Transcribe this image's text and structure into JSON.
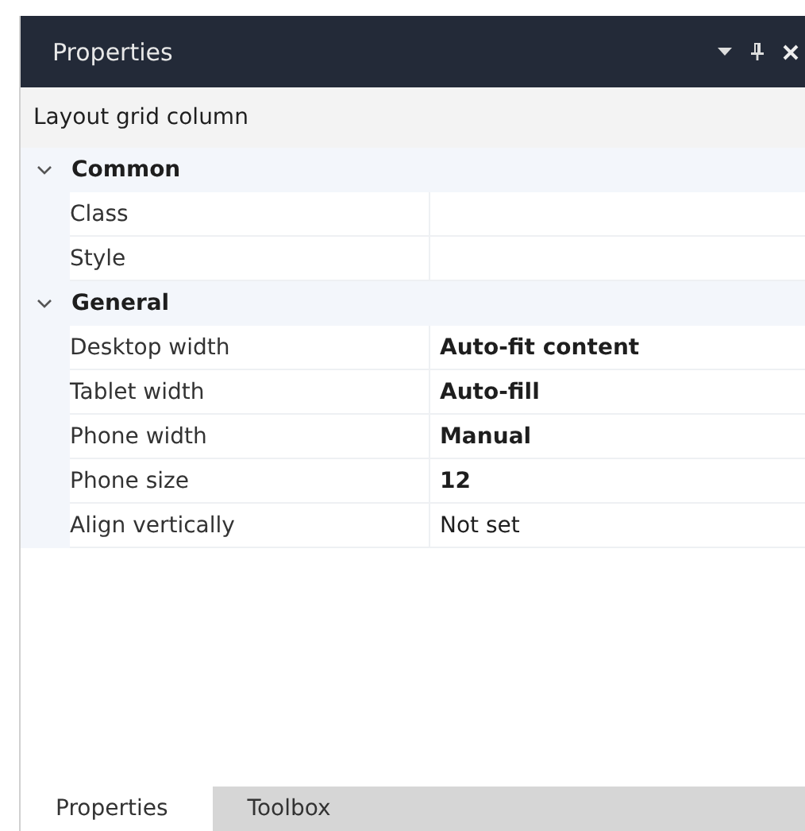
{
  "panel": {
    "title": "Properties",
    "object_name": "Layout grid column"
  },
  "groups": [
    {
      "label": "Common",
      "expanded": true,
      "properties": [
        {
          "name": "Class",
          "modified": false
        },
        {
          "name": "Style",
          "modified": false
        }
      ]
    },
    {
      "label": "General",
      "expanded": true,
      "properties": [
        {
          "name": "Desktop width",
          "value": "Auto-fit content",
          "modified": true
        },
        {
          "name": "Tablet width",
          "value": "Auto-fill",
          "modified": true
        },
        {
          "name": "Phone width",
          "value": "Manual",
          "modified": true
        },
        {
          "name": "Phone size",
          "value": "12",
          "modified": true
        },
        {
          "name": "Align vertically",
          "value": "Not set",
          "modified": false
        }
      ]
    }
  ],
  "tabs": [
    {
      "label": "Properties",
      "selected": true
    },
    {
      "label": "Toolbox",
      "selected": false
    }
  ]
}
